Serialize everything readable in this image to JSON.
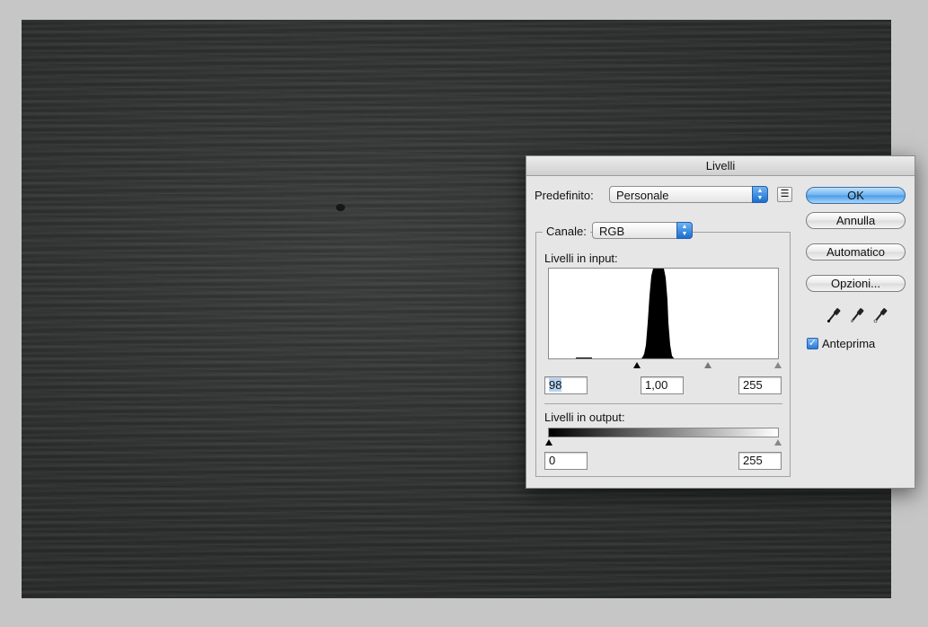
{
  "dialog": {
    "title": "Livelli",
    "preset_label": "Predefinito:",
    "preset_value": "Personale",
    "channel_label": "Canale:",
    "channel_value": "RGB",
    "input_levels_label": "Livelli in input:",
    "input_black": "98",
    "input_gamma": "1,00",
    "input_white": "255",
    "output_levels_label": "Livelli in output:",
    "output_black": "0",
    "output_white": "255"
  },
  "buttons": {
    "ok": "OK",
    "cancel": "Annulla",
    "auto": "Automatico",
    "options": "Opzioni..."
  },
  "preview": {
    "label": "Anteprima",
    "checked": true
  },
  "icons": [
    "black-eyedropper-icon",
    "gray-eyedropper-icon",
    "white-eyedropper-icon",
    "preset-options-icon"
  ],
  "colors": {
    "default_button": "#4a9be8",
    "canvas": "#2c2e2e"
  }
}
